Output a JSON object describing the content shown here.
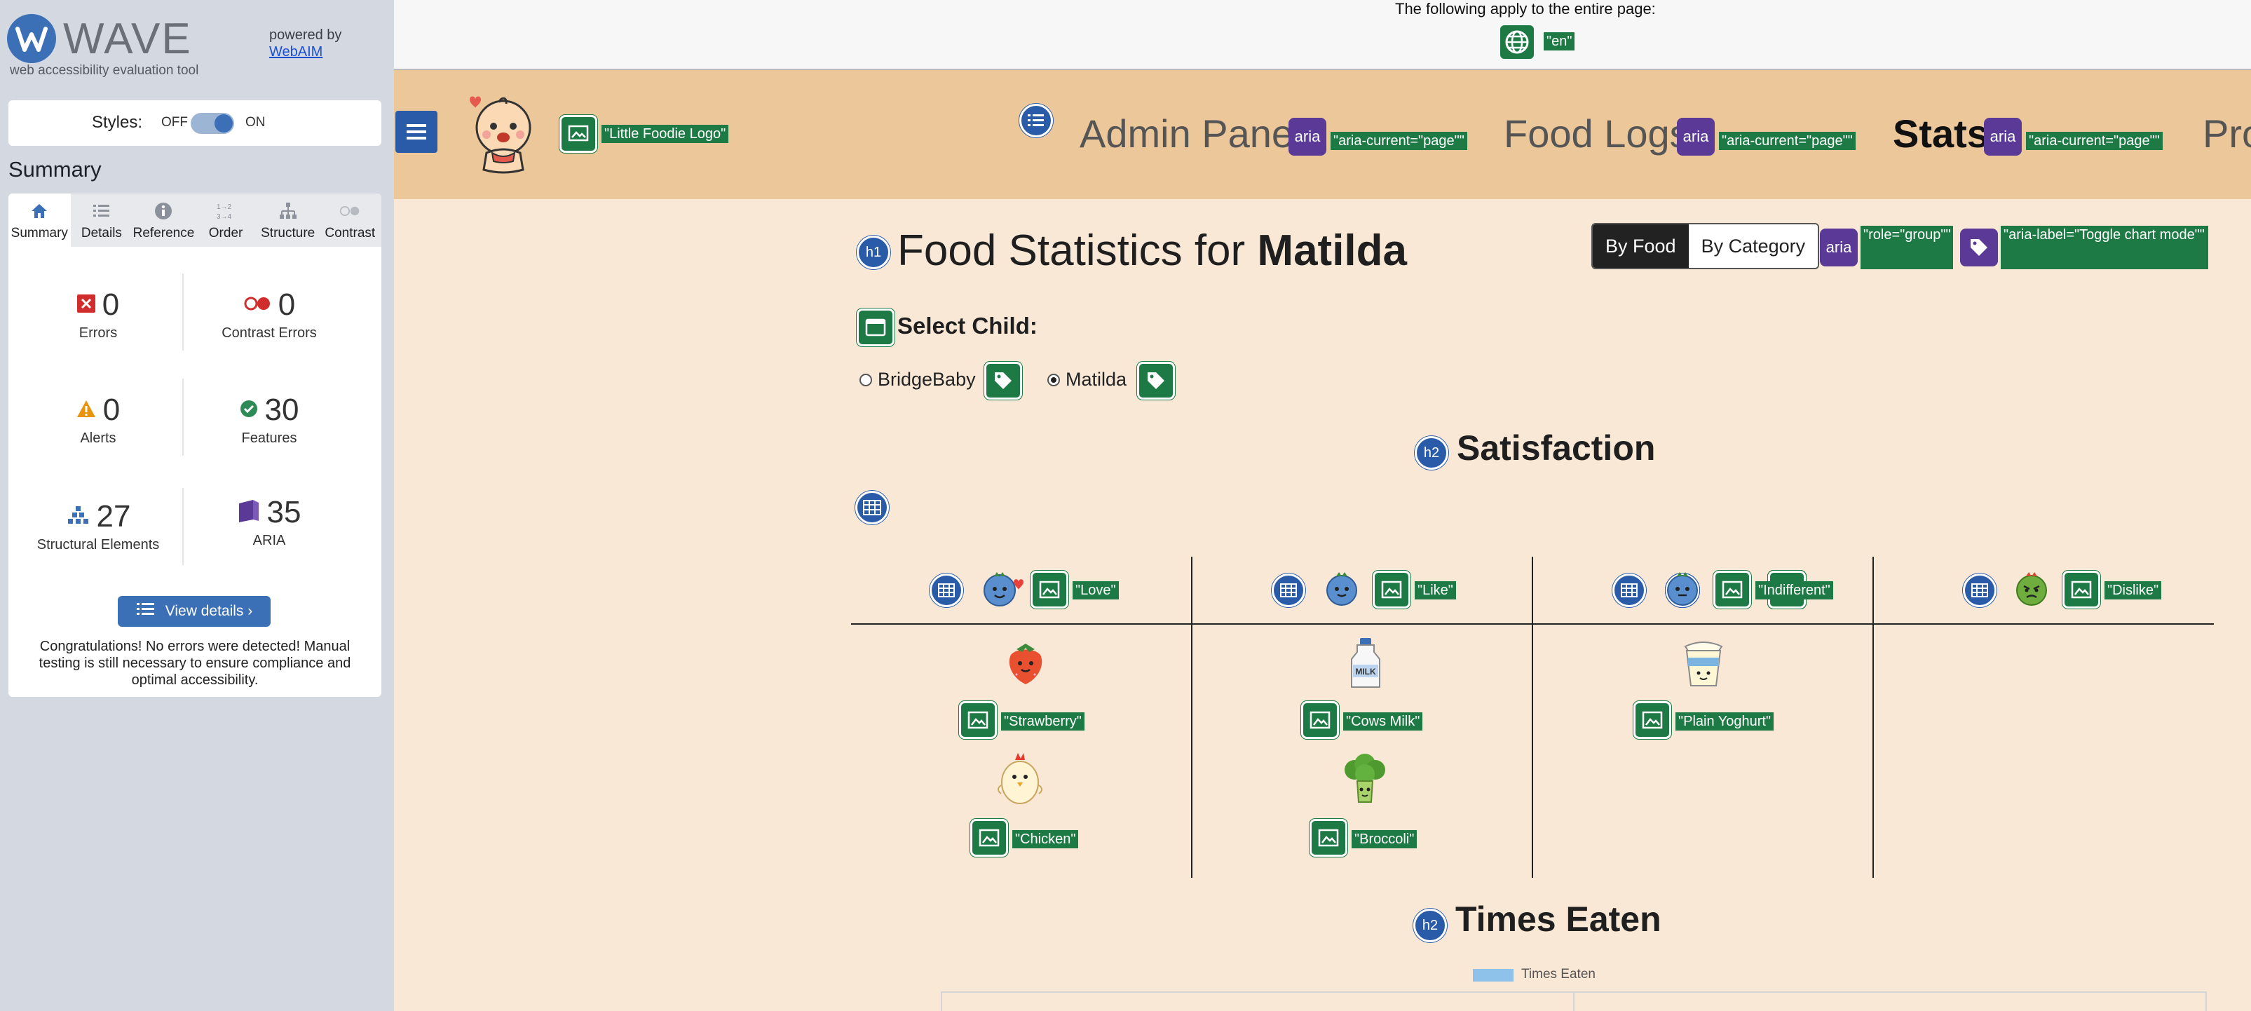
{
  "wave": {
    "logo_text": "WAVE",
    "tagline": "web accessibility evaluation tool",
    "powered_by": "powered by",
    "webaim_link": "WebAIM",
    "styles_label": "Styles:",
    "styles_off": "OFF",
    "styles_on": "ON",
    "summary_heading": "Summary",
    "tabs": [
      {
        "label": "Summary",
        "icon": "home-icon"
      },
      {
        "label": "Details",
        "icon": "list-icon"
      },
      {
        "label": "Reference",
        "icon": "info-icon"
      },
      {
        "label": "Order",
        "icon": "order-icon"
      },
      {
        "label": "Structure",
        "icon": "structure-icon"
      },
      {
        "label": "Contrast",
        "icon": "contrast-icon"
      }
    ],
    "stats": {
      "errors": {
        "value": "0",
        "label": "Errors"
      },
      "contrast_errors": {
        "value": "0",
        "label": "Contrast Errors"
      },
      "alerts": {
        "value": "0",
        "label": "Alerts"
      },
      "features": {
        "value": "30",
        "label": "Features"
      },
      "structural": {
        "value": "27",
        "label": "Structural Elements"
      },
      "aria": {
        "value": "35",
        "label": "ARIA"
      }
    },
    "view_details": "View details ›",
    "congrats": "Congratulations! No errors were detected! Manual testing is still necessary to ensure compliance and optimal accessibility."
  },
  "page": {
    "lang_notice": "The following apply to the entire page:",
    "lang_tag": "\"en\"",
    "logo_alt_tag": "\"Little Foodie Logo\"",
    "nav": [
      {
        "label": "Admin Panel",
        "aria_tag": "\"aria-current=\"page\"\""
      },
      {
        "label": "Food Logs",
        "aria_tag": "\"aria-current=\"page\"\""
      },
      {
        "label": "Stats",
        "aria_tag": "\"aria-current=\"page\"\""
      },
      {
        "label": "Pro"
      }
    ],
    "aria_badge": "aria",
    "h1_badge": "h1",
    "h2_badge": "h2",
    "title_prefix": "Food Statistics for ",
    "title_name": "Matilda",
    "toggle": {
      "by_food": "By Food",
      "by_category": "By Category"
    },
    "role_group_tag": "\"role=\"group\"\"",
    "aria_label_tag": "\"aria-label=\"Toggle chart mode\"\"",
    "select_child": "Select Child:",
    "children": [
      {
        "label": "BridgeBaby",
        "checked": false
      },
      {
        "label": "Matilda",
        "checked": true
      }
    ],
    "satisfaction_heading": "Satisfaction",
    "columns": [
      {
        "alt": "\"Love\""
      },
      {
        "alt": "\"Like\""
      },
      {
        "alt": "\"Indifferent\""
      },
      {
        "alt": "\"Dislike\""
      }
    ],
    "foods": [
      {
        "alt": "\"Strawberry\""
      },
      {
        "alt": "\"Chicken\""
      },
      {
        "alt": "\"Cows Milk\""
      },
      {
        "alt": "\"Broccoli\""
      },
      {
        "alt": "\"Plain Yoghurt\""
      }
    ],
    "times_eaten_heading": "Times Eaten",
    "legend_label": "Times Eaten"
  },
  "colors": {
    "feature_green": "#1e7a44",
    "aria_purple": "#5a3a96",
    "structure_blue": "#2a5ba8",
    "nav_bg": "#ecc79a",
    "page_bg": "#fae8d6"
  }
}
